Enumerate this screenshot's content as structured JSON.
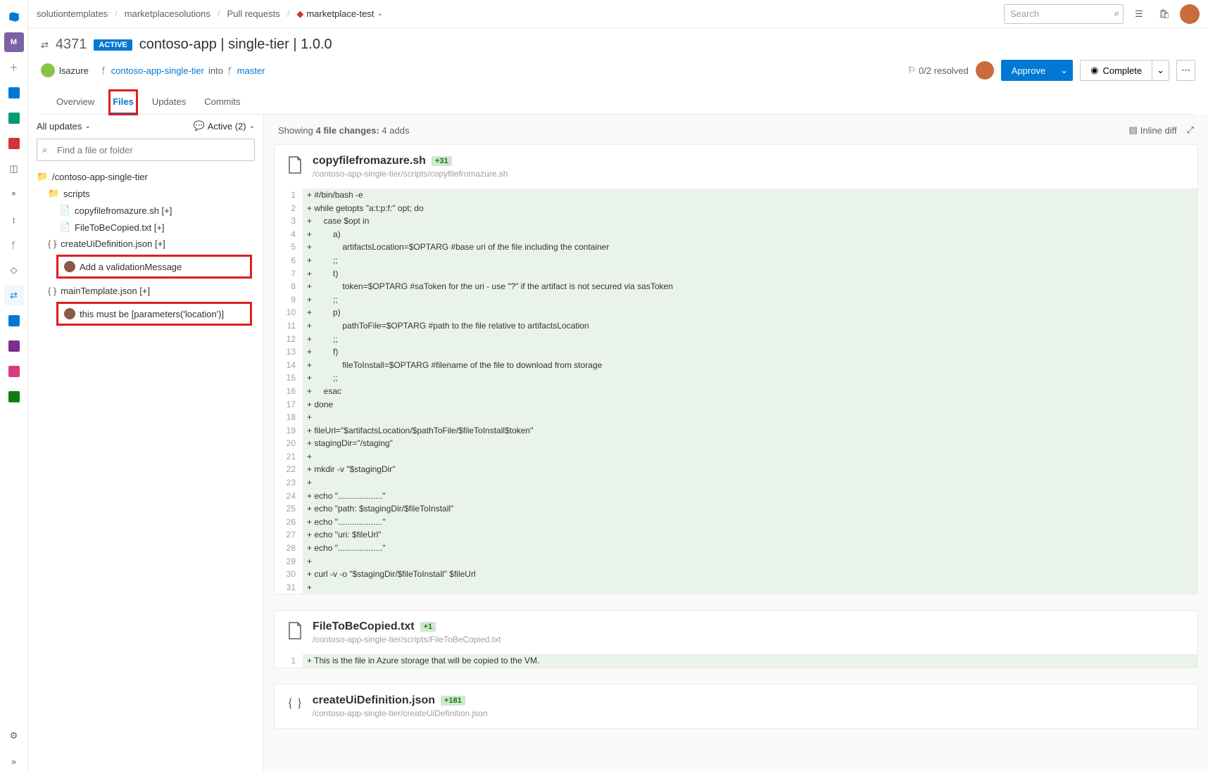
{
  "breadcrumbs": [
    "solutiontemplates",
    "marketplacesolutions",
    "Pull requests",
    "marketplace-test"
  ],
  "search_placeholder": "Search",
  "pr": {
    "number": "4371",
    "status": "ACTIVE",
    "title": "contoso-app | single-tier | 1.0.0",
    "author": "lsazure",
    "source_branch": "contoso-app-single-tier",
    "into": "into",
    "target_branch": "master",
    "resolved": "0/2 resolved",
    "approve": "Approve",
    "complete": "Complete"
  },
  "tabs": {
    "overview": "Overview",
    "files": "Files",
    "updates": "Updates",
    "commits": "Commits"
  },
  "side": {
    "all_updates": "All updates",
    "active": "Active (2)",
    "find_placeholder": "Find a file or folder",
    "root": "/contoso-app-single-tier",
    "scripts": "scripts",
    "f1": "copyfilefromazure.sh [+]",
    "f2": "FileToBeCopied.txt [+]",
    "f3": "createUiDefinition.json [+]",
    "f4": "mainTemplate.json [+]",
    "c1": "Add a validationMessage",
    "c2": "this must be [parameters('location')]"
  },
  "contbar": {
    "summary_a": "Showing ",
    "summary_b": "4 file changes:",
    "summary_c": "  4 adds",
    "inline": "Inline diff"
  },
  "file1": {
    "name": "copyfilefromazure.sh",
    "delta": "+31",
    "path": "/contoso-app-single-tier/scripts/copyfilefromazure.sh",
    "lines": [
      "+ #/bin/bash -e",
      "+ while getopts \"a:t:p:f:\" opt; do",
      "+     case $opt in",
      "+         a)",
      "+             artifactsLocation=$OPTARG #base uri of the file including the container",
      "+         ;;",
      "+         t)",
      "+             token=$OPTARG #saToken for the uri - use \"?\" if the artifact is not secured via sasToken",
      "+         ;;",
      "+         p)",
      "+             pathToFile=$OPTARG #path to the file relative to artifactsLocation",
      "+         ;;",
      "+         f)",
      "+             fileToInstall=$OPTARG #filename of the file to download from storage",
      "+         ;;",
      "+     esac",
      "+ done",
      "+ ",
      "+ fileUrl=\"$artifactsLocation/$pathToFile/$fileToInstall$token\"",
      "+ stagingDir=\"/staging\"",
      "+ ",
      "+ mkdir -v \"$stagingDir\"",
      "+ ",
      "+ echo \"...................\"",
      "+ echo \"path: $stagingDir/$fileToInstall\"",
      "+ echo \"...................\"",
      "+ echo \"uri: $fileUrl\"",
      "+ echo \"...................\"",
      "+ ",
      "+ curl -v -o \"$stagingDir/$fileToInstall\" $fileUrl",
      "+ "
    ]
  },
  "file2": {
    "name": "FileToBeCopied.txt",
    "delta": "+1",
    "path": "/contoso-app-single-tier/scripts/FileToBeCopied.txt",
    "lines": [
      "+ This is the file in Azure storage that will be copied to the VM."
    ]
  },
  "file3": {
    "name": "createUiDefinition.json",
    "delta": "+181",
    "path": "/contoso-app-single-tier/createUiDefinition.json"
  }
}
